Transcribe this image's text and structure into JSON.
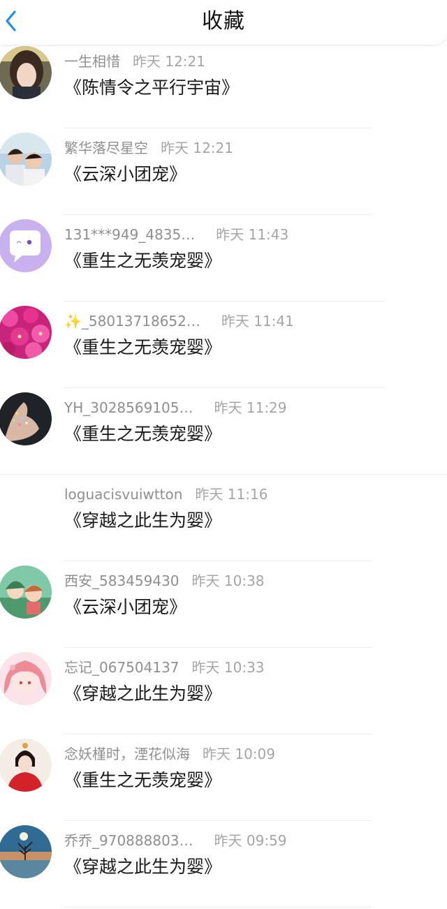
{
  "header": {
    "title": "收藏"
  },
  "items": [
    {
      "name": "一生相惜",
      "time": "昨天 12:21",
      "book": "《陈情令之平行宇宙》",
      "avatar": "woman-selfie"
    },
    {
      "name": "繁华落尽星空",
      "time": "昨天 12:21",
      "book": "《云深小团宠》",
      "avatar": "mother-child-photo"
    },
    {
      "name": "131***949_4835…",
      "time": "昨天 11:43",
      "book": "《重生之无羡宠婴》",
      "avatar": "chat-bubble-cartoon"
    },
    {
      "name": "✨_58013718652…",
      "time": "昨天 11:41",
      "book": "《重生之无羡宠婴》",
      "avatar": "pink-flowers"
    },
    {
      "name": "YH_3028569105…",
      "time": "昨天 11:29",
      "book": "《重生之无羡宠婴》",
      "avatar": "hand-sparkles"
    },
    {
      "name": "loguacisvuiwtton",
      "time": "昨天 11:16",
      "book": "《穿越之此生为婴》",
      "avatar": ""
    },
    {
      "name": "西安_583459430",
      "time": "昨天 10:38",
      "book": "《云深小团宠》",
      "avatar": "cartoon-kids"
    },
    {
      "name": "忘记_067504137",
      "time": "昨天 10:33",
      "book": "《穿越之此生为婴》",
      "avatar": "anime-girl-pink"
    },
    {
      "name": "念妖槿时，湮花似海",
      "time": "昨天 10:09",
      "book": "《重生之无羡宠婴》",
      "avatar": "costume-girl-red"
    },
    {
      "name": "乔乔_970888803…",
      "time": "昨天 09:59",
      "book": "《穿越之此生为婴》",
      "avatar": "moon-tree-lake"
    }
  ]
}
